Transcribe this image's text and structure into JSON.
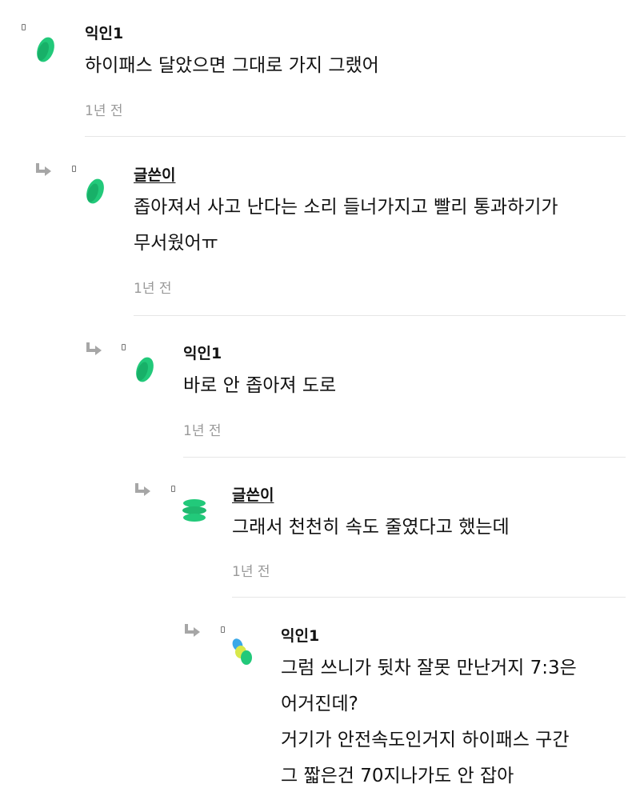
{
  "comments": [
    {
      "author": "익인1",
      "lines": [
        "하이패스 달았으면 그대로 가지 그랬어"
      ],
      "time": "1년 전",
      "avatar_icon": "green-leaf-icon"
    },
    {
      "author": "글쓴이",
      "lines": [
        "좁아져서 사고 난다는 소리 들너가지고 빨리 통과하기가",
        "무서웠어ㅠ"
      ],
      "time": "1년 전",
      "avatar_icon": "green-leaf-icon"
    },
    {
      "author": "익인1",
      "lines": [
        "바로 안 좁아져 도로"
      ],
      "time": "1년 전",
      "avatar_icon": "green-leaf-icon"
    },
    {
      "author": "글쓴이",
      "lines": [
        "그래서 천천히 속도 줄였다고 했는데"
      ],
      "time": "1년 전",
      "avatar_icon": "green-stack-icon"
    },
    {
      "author": "익인1",
      "lines": [
        "그럼 쓰니가 뒷차 잘못 만난거지 7:3은",
        "어거진데?",
        "거기가 안전속도인거지 하이패스 구간",
        "그 짧은건 70지나가도 안 잡아"
      ],
      "time": "",
      "avatar_icon": "multicolor-blob-icon"
    }
  ],
  "colors": {
    "leaf_green": "#22c97a",
    "leaf_dark": "#119a5a",
    "reply_arrow": "#a6a6a6",
    "time_gray": "#999999",
    "divider": "#e6e6e6"
  }
}
